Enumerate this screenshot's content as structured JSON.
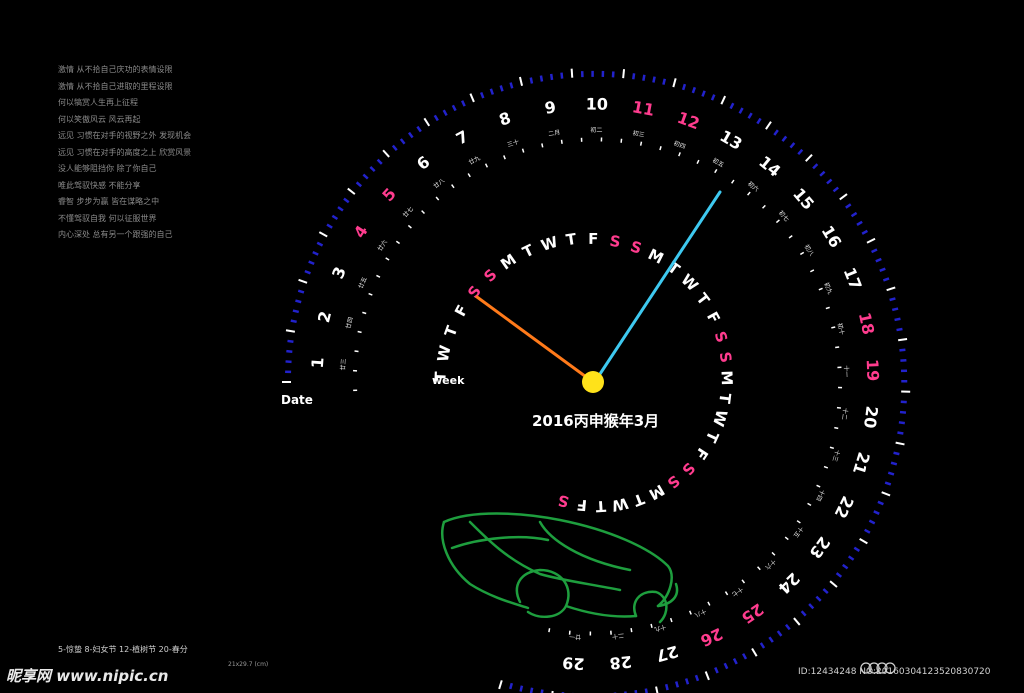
{
  "quotes": [
    "激情  从不拾自己庆功的表情设限",
    "激情  从不拾自己进取的里程设限",
    "何以犒赏人生再上征程",
    "何以笑傲风云  风云再起",
    "远见  习惯在对手的视野之外  发现机会",
    "远见  习惯在对手的高度之上  欣赏风景",
    "没人能够阻挡你  除了你自己",
    "唯此驾驭快感  不能分享",
    "睿智  步步为赢  皆在谋略之中",
    "不懂驾驭自我  何以征服世界",
    "内心深处  总有另一个跟强的自己"
  ],
  "calendar": {
    "title": "2016丙申猴年3月",
    "date_label": "Date",
    "week_label": "week",
    "days": [
      "1",
      "2",
      "3",
      "4",
      "5",
      "6",
      "7",
      "8",
      "9",
      "10",
      "11",
      "12",
      "13",
      "14",
      "15",
      "16",
      "17",
      "18",
      "19",
      "20",
      "21",
      "22",
      "23",
      "24",
      "25",
      "26",
      "27",
      "28",
      "29"
    ],
    "lunar": [
      "廿三",
      "廿四",
      "廿五",
      "廿六",
      "廿七",
      "廿八",
      "廿九",
      "三十",
      "二月",
      "初二",
      "初三",
      "初四",
      "初五",
      "初六",
      "初七",
      "初八",
      "初九",
      "初十",
      "十一",
      "十二",
      "十三",
      "十四",
      "十五",
      "十六",
      "十七",
      "十八",
      "十九",
      "二十",
      "廿一"
    ],
    "weekend_days": [
      "4",
      "5",
      "11",
      "12",
      "18",
      "19",
      "25",
      "26"
    ],
    "week_letters": "TWTFSSMTWTFSSMTWTFSSMTWTFSSMTWTFS",
    "weekend_letters": [
      "S"
    ]
  },
  "footer": {
    "festivals": "5-惊蛰    8-妇女节   12-植树节   20-春分",
    "size_note": "21x29.7 (cm)",
    "watermark": "昵享网 www.nipic.cn",
    "id_text": "ID:12434248 NO:20160304123520830720"
  },
  "colors": {
    "background": "#000000",
    "day_text": "#ffffff",
    "weekend_accent": "#ff3c8e",
    "outer_ring": "#2222cc",
    "hour_hand": "#ff7a1a",
    "minute_hand": "#3ec9f0",
    "hub": "#ffe21a",
    "car_outline": "#1e9e3e"
  },
  "icons": [
    "audi-rings-icon",
    "car-outline-icon"
  ]
}
